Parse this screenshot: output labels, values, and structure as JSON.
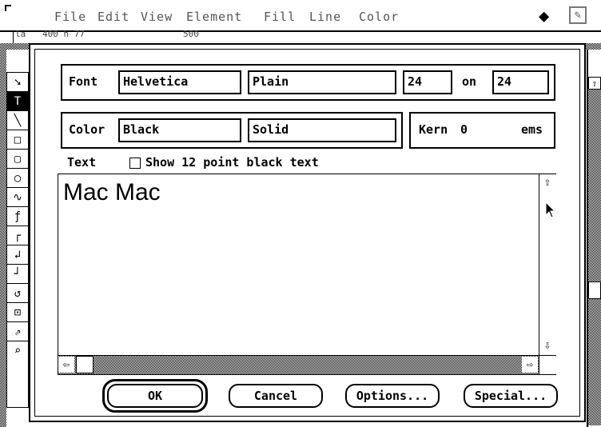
{
  "menubar": {
    "apple_glyph": "",
    "menus": [
      "File",
      "Edit",
      "View",
      "Element",
      "Fill",
      "Line",
      "Color"
    ],
    "diamond_glyph": "◆"
  },
  "coords": [
    "la",
    "400  h  77",
    "500"
  ],
  "dialog": {
    "font_label": "Font",
    "font_name": "Helvetica",
    "font_style": "Plain",
    "font_size": "24",
    "on_label": "on",
    "leading": "24",
    "color_label": "Color",
    "color_value": "Black",
    "pattern_value": "Solid",
    "kern_label": "Kern",
    "kern_value": "0",
    "kern_unit": "ems",
    "text_label": "Text",
    "show_checkbox_label": "Show 12 point black text",
    "show_checked": false,
    "text_content": "Mac Mac",
    "ok_label": "OK",
    "cancel_label": "Cancel",
    "options_label": "Options...",
    "special_label": "Special..."
  },
  "tools": [
    "pointer-tool",
    "text-tool",
    "line-tool",
    "rectangle-tool",
    "rounded-rect-tool",
    "oval-tool",
    "freehand-tool",
    "pen-tool-1",
    "pen-tool-2",
    "pen-tool-3",
    "pen-tool-4",
    "pen-tool-5",
    "pen-tool-6",
    "reshape-tool",
    "zoom-tool"
  ],
  "colors": {
    "ink": "#000000",
    "paper": "#ffffff"
  }
}
